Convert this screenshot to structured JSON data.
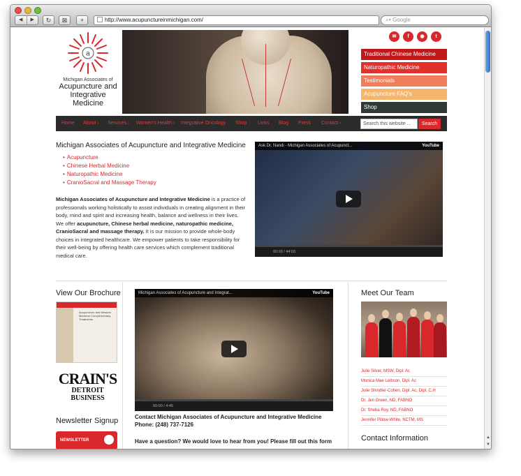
{
  "browser": {
    "url": "http://www.acupunctureinmichigan.com/",
    "search_placeholder": "Google",
    "back_glyph": "◀",
    "forward_glyph": "▶",
    "reload_glyph": "↻",
    "reader_glyph": "⊠",
    "newtab_glyph": "+"
  },
  "logo": {
    "line1": "Michigan Associates of",
    "line2": "Acupuncture and",
    "line3": "Integrative Medicine",
    "letter": "a"
  },
  "social": [
    "✉",
    "f",
    "◉",
    "t"
  ],
  "side_menu": [
    {
      "label": "Traditional Chinese Medicine",
      "color": "#c0171b"
    },
    {
      "label": "Naturopathic Medicine",
      "color": "#e0312d"
    },
    {
      "label": "Testimonials",
      "color": "#ef7d5a"
    },
    {
      "label": "Acupuncture FAQ's",
      "color": "#f6b56a"
    },
    {
      "label": "Shop",
      "color": "#2f3a34"
    }
  ],
  "nav": {
    "items": [
      "Home",
      "About ›",
      "Services ›",
      "Women's Health ›",
      "Integrative Oncology",
      "Shop",
      "Links",
      "Blog",
      "Press",
      "Contact ›"
    ],
    "search_value": "Search this website ...",
    "search_button": "Search"
  },
  "intro": {
    "title": "Michigan Associates of Acupuncture and Integrative Medicine",
    "links": [
      "Acupuncture",
      "Chinese Herbal Medicine",
      "Naturopathic Medicine",
      "CranioSacral and Massage Therapy"
    ],
    "p1_bold": "Michigan Associates of Acupuncture and Integrative Medicine",
    "p1_rest": " is a practice of professionals working holistically to assist individuals in creating alignment in their body, mind and spirit and increasing health, balance and wellness in their lives.",
    "p2_start": "We offer ",
    "p2_bold": "acupuncture, Chinese herbal medicine,  naturopathic medicine, CranioSacral and massage therapy.",
    "p2_rest": "  It is our mission to provide whole-body choices in integrated healthcare. We empower patients to take responsibility for their well-being by offering health care services which complement traditional medical care."
  },
  "video1": {
    "title": "Ask Dr. Nandi - Michigan Associates of Acupunct...",
    "brand": "YouTube",
    "time": "00:00 / 44:03"
  },
  "video2": {
    "title": "Michigan Associates of Acupuncture and Integrat...",
    "brand": "YouTube",
    "time": "00:00 / 4:45"
  },
  "brochure": {
    "heading": "View Our Brochure",
    "text": "Acupuncture and Western Medicine Complementary Treatments"
  },
  "crains": {
    "line1": "CRAIN'S",
    "line2": "DETROIT BUSINESS"
  },
  "newsletter": {
    "heading": "Newsletter Signup",
    "badge": "NEWSLETTER"
  },
  "contact": {
    "line1": "Contact Michigan Associates of Acupuncture and Integrative Medicine",
    "line2": "Phone: (248) 737-7126",
    "question": "Have a question? We would love to hear from you! Please fill out this form"
  },
  "team": {
    "heading": "Meet Our Team",
    "members": [
      "Julie Silver, MSW, Dipl. Ac",
      "Monica Mae Leibson, Dipl. Ac",
      "Julie Shindler-Cohen, Dipl. Ac, Dipl. C.H",
      "Dr. Jen Green, ND, FABNO",
      "Dr. Sheba Roy, ND, FABNO",
      "Jennifer Pillow-White, NCTM, MS"
    ]
  },
  "contact_info_heading": "Contact Information"
}
